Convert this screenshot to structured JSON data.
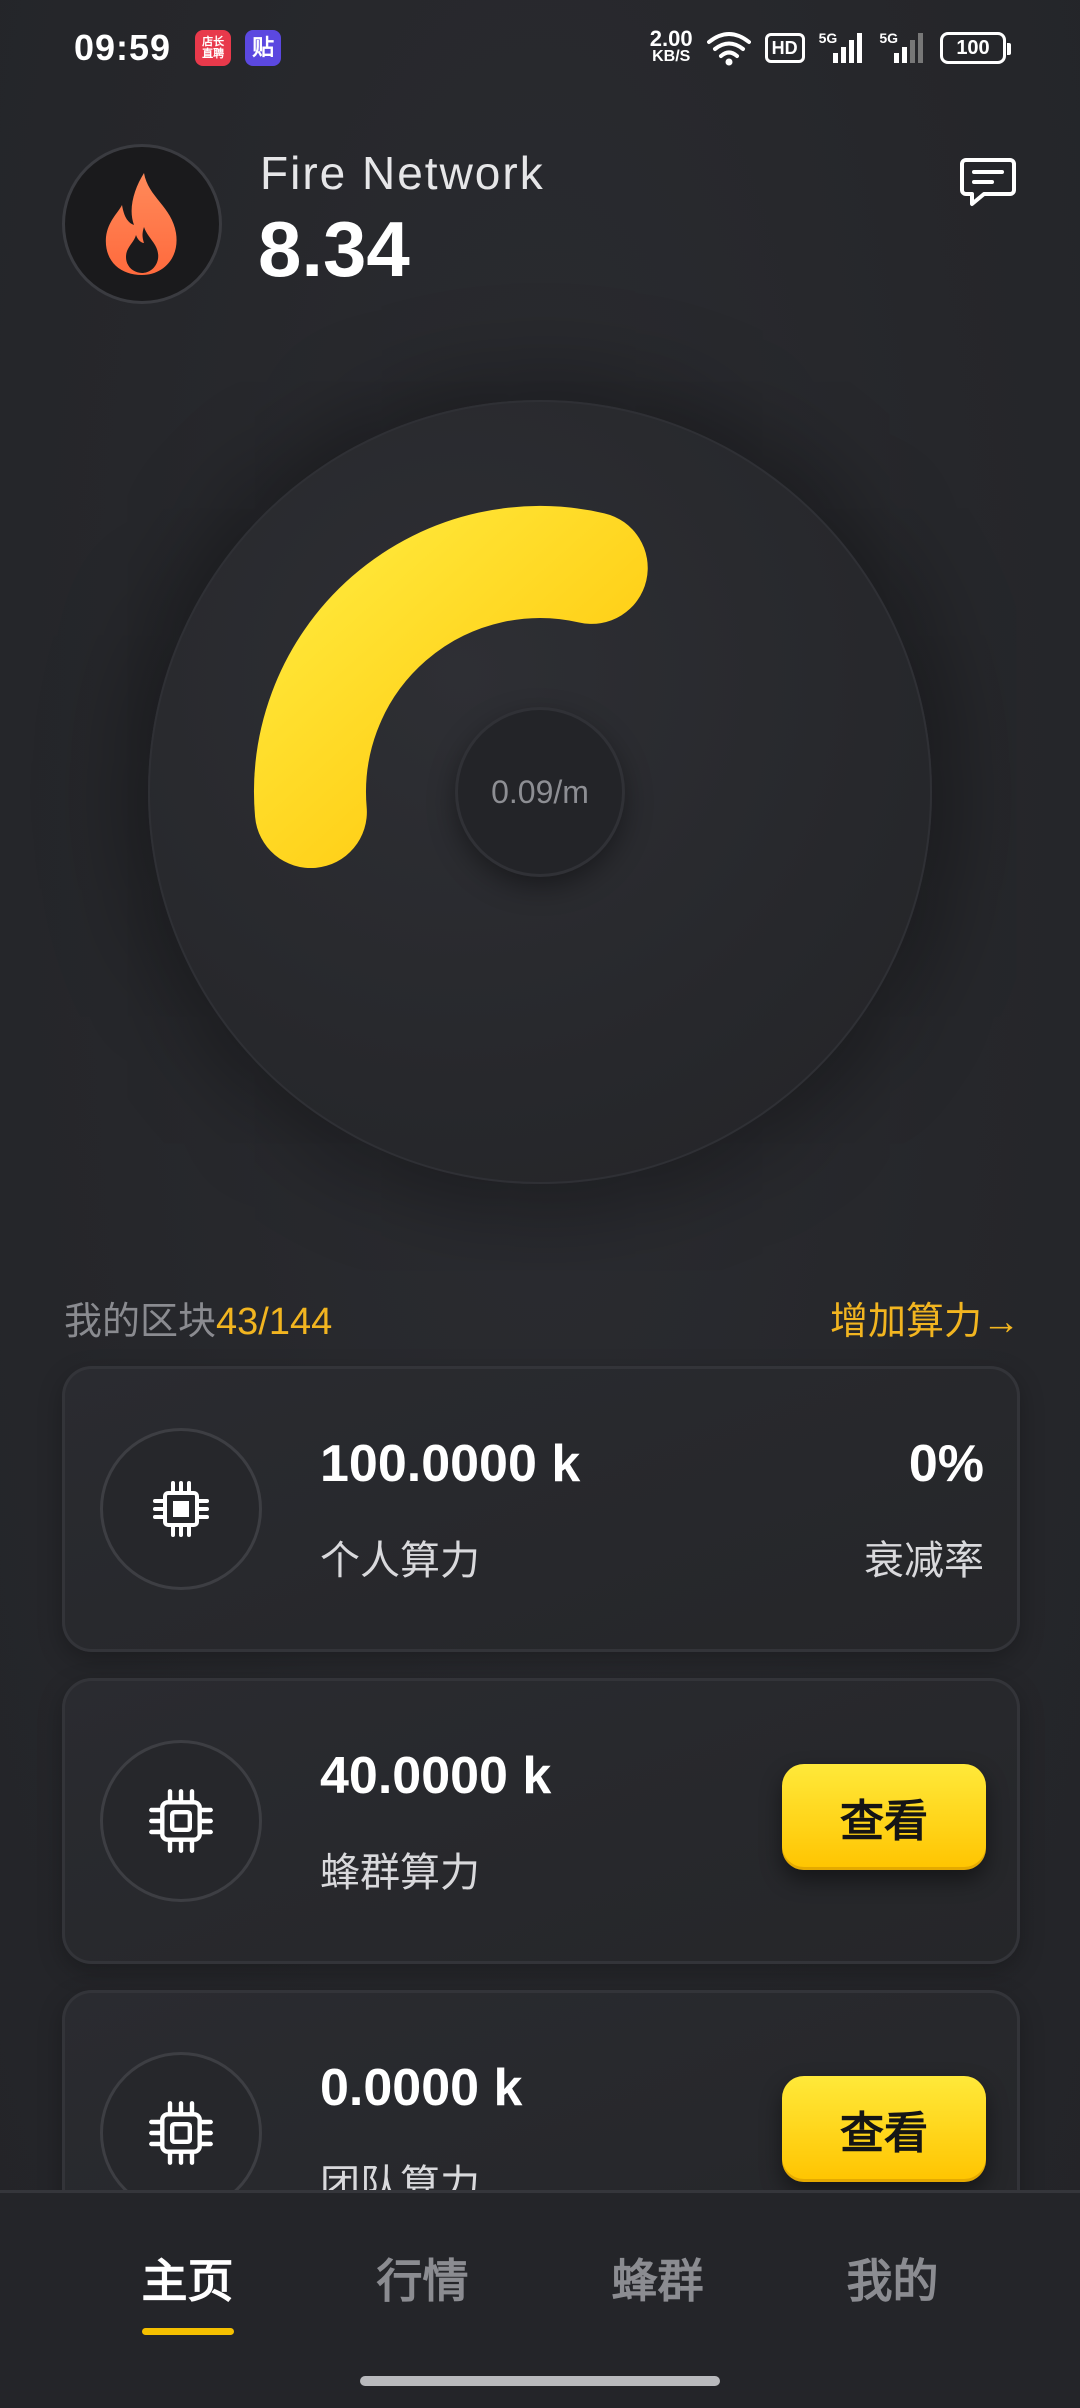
{
  "status_bar": {
    "time": "09:59",
    "app_badge_1": "店长\n直聘",
    "app_badge_2": "贴",
    "net_speed_value": "2.00",
    "net_speed_unit": "KB/S",
    "hd_label": "HD",
    "sig1_label": "5G",
    "sig2_label": "5G",
    "battery": "100",
    "icons": [
      "wifi-icon",
      "signal-icon",
      "battery-icon"
    ]
  },
  "header": {
    "app_name": "Fire Network",
    "balance": "8.34",
    "logo_icon": "flame-icon",
    "message_icon": "message-icon"
  },
  "dial": {
    "rate": "0.09/m",
    "progress_fraction": 0.3,
    "arc_color": "#ffd21f"
  },
  "blocks": {
    "label": "我的区块",
    "count": "43/144",
    "add_power": "增加算力→"
  },
  "cards": [
    {
      "icon": "chip-icon",
      "value": "100.0000 k",
      "label": "个人算力",
      "right_value": "0%",
      "right_label": "衰减率"
    },
    {
      "icon": "chip-icon",
      "value": "40.0000 k",
      "label": "蜂群算力",
      "button": "查看"
    },
    {
      "icon": "chip-icon",
      "value": "0.0000 k",
      "label": "团队算力",
      "button": "查看"
    }
  ],
  "nav": {
    "items": [
      "主页",
      "行情",
      "蜂群",
      "我的"
    ],
    "active": "主页"
  },
  "colors": {
    "accent": "#f2b520",
    "background": "#26272b",
    "button": "#ffd21f"
  }
}
